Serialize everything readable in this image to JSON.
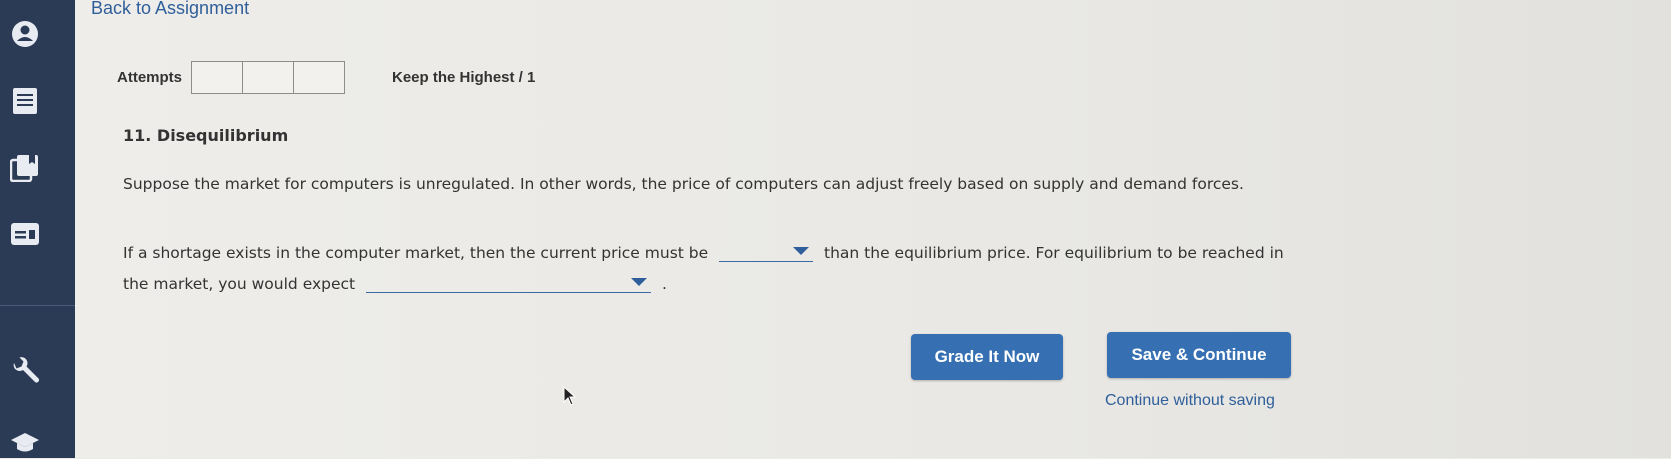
{
  "header": {
    "back_link": "Back to Assignment"
  },
  "attempts": {
    "label": "Attempts",
    "box_count": 3,
    "keep_highest": "Keep the Highest / 1"
  },
  "question": {
    "title": "11. Disequilibrium",
    "intro": "Suppose the market for computers is unregulated. In other words, the price of computers can adjust freely based on supply and demand forces.",
    "line1_before": "If a shortage exists in the computer market, then the current price must be",
    "line1_after": "than the equilibrium price. For equilibrium to be reached in",
    "line2_before": "the market, you would expect",
    "line2_after": "."
  },
  "buttons": {
    "grade": "Grade It Now",
    "save": "Save & Continue",
    "continue_without_saving": "Continue without saving"
  },
  "sidebar": {
    "icons": [
      "user-icon",
      "list-icon",
      "book-copy-icon",
      "card-icon",
      "wrench-icon",
      "graduation-cap-icon"
    ]
  },
  "colors": {
    "sidebar": "#2b3a55",
    "accent": "#3670b3",
    "link": "#2f5f9a"
  }
}
